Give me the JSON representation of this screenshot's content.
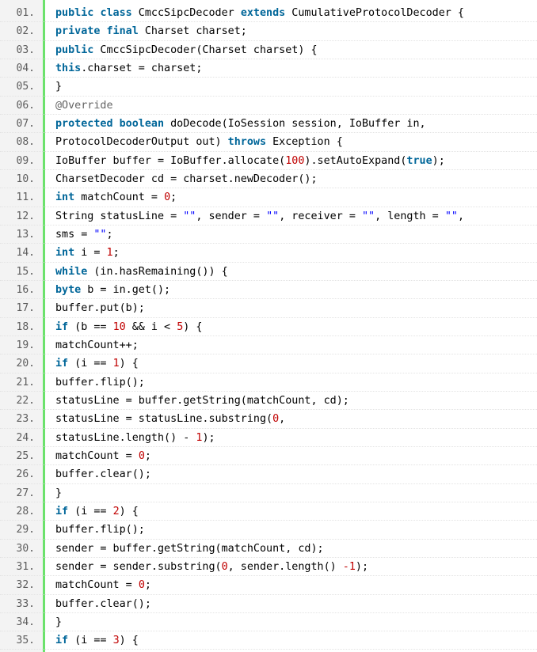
{
  "colors": {
    "keyword": "#006699",
    "number": "#c00000",
    "string": "#0000ff",
    "annotation": "#646464",
    "plain": "#000000",
    "gutter_bg": "#f3f3f3",
    "gutter_border": "#6ce26c",
    "line_number": "#5c5c5c"
  },
  "code": {
    "lines": [
      {
        "num": "01.",
        "tokens": [
          {
            "t": "k",
            "v": "public"
          },
          {
            "t": "p",
            "v": " "
          },
          {
            "t": "k",
            "v": "class"
          },
          {
            "t": "p",
            "v": " CmccSipcDecoder "
          },
          {
            "t": "k",
            "v": "extends"
          },
          {
            "t": "p",
            "v": " CumulativeProtocolDecoder {"
          }
        ]
      },
      {
        "num": "02.",
        "tokens": [
          {
            "t": "k",
            "v": "private"
          },
          {
            "t": "p",
            "v": " "
          },
          {
            "t": "k",
            "v": "final"
          },
          {
            "t": "p",
            "v": " Charset charset;"
          }
        ]
      },
      {
        "num": "03.",
        "tokens": [
          {
            "t": "k",
            "v": "public"
          },
          {
            "t": "p",
            "v": " CmccSipcDecoder(Charset charset) {"
          }
        ]
      },
      {
        "num": "04.",
        "tokens": [
          {
            "t": "k",
            "v": "this"
          },
          {
            "t": "p",
            "v": ".charset = charset;"
          }
        ]
      },
      {
        "num": "05.",
        "tokens": [
          {
            "t": "p",
            "v": "}"
          }
        ]
      },
      {
        "num": "06.",
        "tokens": [
          {
            "t": "a",
            "v": "@Override"
          }
        ]
      },
      {
        "num": "07.",
        "tokens": [
          {
            "t": "k",
            "v": "protected"
          },
          {
            "t": "p",
            "v": " "
          },
          {
            "t": "k",
            "v": "boolean"
          },
          {
            "t": "p",
            "v": " doDecode(IoSession session, IoBuffer in,"
          }
        ]
      },
      {
        "num": "08.",
        "tokens": [
          {
            "t": "p",
            "v": "ProtocolDecoderOutput out) "
          },
          {
            "t": "k",
            "v": "throws"
          },
          {
            "t": "p",
            "v": " Exception {"
          }
        ]
      },
      {
        "num": "09.",
        "tokens": [
          {
            "t": "p",
            "v": "IoBuffer buffer = IoBuffer.allocate("
          },
          {
            "t": "n",
            "v": "100"
          },
          {
            "t": "p",
            "v": ").setAutoExpand("
          },
          {
            "t": "k",
            "v": "true"
          },
          {
            "t": "p",
            "v": ");"
          }
        ]
      },
      {
        "num": "10.",
        "tokens": [
          {
            "t": "p",
            "v": "CharsetDecoder cd = charset.newDecoder();"
          }
        ]
      },
      {
        "num": "11.",
        "tokens": [
          {
            "t": "k",
            "v": "int"
          },
          {
            "t": "p",
            "v": " matchCount = "
          },
          {
            "t": "n",
            "v": "0"
          },
          {
            "t": "p",
            "v": ";"
          }
        ]
      },
      {
        "num": "12.",
        "tokens": [
          {
            "t": "p",
            "v": "String statusLine = "
          },
          {
            "t": "s",
            "v": "\"\""
          },
          {
            "t": "p",
            "v": ", sender = "
          },
          {
            "t": "s",
            "v": "\"\""
          },
          {
            "t": "p",
            "v": ", receiver = "
          },
          {
            "t": "s",
            "v": "\"\""
          },
          {
            "t": "p",
            "v": ", length = "
          },
          {
            "t": "s",
            "v": "\"\""
          },
          {
            "t": "p",
            "v": ","
          }
        ]
      },
      {
        "num": "13.",
        "tokens": [
          {
            "t": "p",
            "v": "sms = "
          },
          {
            "t": "s",
            "v": "\"\""
          },
          {
            "t": "p",
            "v": ";"
          }
        ]
      },
      {
        "num": "14.",
        "tokens": [
          {
            "t": "k",
            "v": "int"
          },
          {
            "t": "p",
            "v": " i = "
          },
          {
            "t": "n",
            "v": "1"
          },
          {
            "t": "p",
            "v": ";"
          }
        ]
      },
      {
        "num": "15.",
        "tokens": [
          {
            "t": "k",
            "v": "while"
          },
          {
            "t": "p",
            "v": " (in.hasRemaining()) {"
          }
        ]
      },
      {
        "num": "16.",
        "tokens": [
          {
            "t": "k",
            "v": "byte"
          },
          {
            "t": "p",
            "v": " b = in.get();"
          }
        ]
      },
      {
        "num": "17.",
        "tokens": [
          {
            "t": "p",
            "v": "buffer.put(b);"
          }
        ]
      },
      {
        "num": "18.",
        "tokens": [
          {
            "t": "k",
            "v": "if"
          },
          {
            "t": "p",
            "v": " (b == "
          },
          {
            "t": "n",
            "v": "10"
          },
          {
            "t": "p",
            "v": " && i < "
          },
          {
            "t": "n",
            "v": "5"
          },
          {
            "t": "p",
            "v": ") {"
          }
        ]
      },
      {
        "num": "19.",
        "tokens": [
          {
            "t": "p",
            "v": "matchCount++;"
          }
        ]
      },
      {
        "num": "20.",
        "tokens": [
          {
            "t": "k",
            "v": "if"
          },
          {
            "t": "p",
            "v": " (i == "
          },
          {
            "t": "n",
            "v": "1"
          },
          {
            "t": "p",
            "v": ") {"
          }
        ]
      },
      {
        "num": "21.",
        "tokens": [
          {
            "t": "p",
            "v": "buffer.flip();"
          }
        ]
      },
      {
        "num": "22.",
        "tokens": [
          {
            "t": "p",
            "v": "statusLine = buffer.getString(matchCount, cd);"
          }
        ]
      },
      {
        "num": "23.",
        "tokens": [
          {
            "t": "p",
            "v": "statusLine = statusLine.substring("
          },
          {
            "t": "n",
            "v": "0"
          },
          {
            "t": "p",
            "v": ","
          }
        ]
      },
      {
        "num": "24.",
        "tokens": [
          {
            "t": "p",
            "v": "statusLine.length() - "
          },
          {
            "t": "n",
            "v": "1"
          },
          {
            "t": "p",
            "v": ");"
          }
        ]
      },
      {
        "num": "25.",
        "tokens": [
          {
            "t": "p",
            "v": "matchCount = "
          },
          {
            "t": "n",
            "v": "0"
          },
          {
            "t": "p",
            "v": ";"
          }
        ]
      },
      {
        "num": "26.",
        "tokens": [
          {
            "t": "p",
            "v": "buffer.clear();"
          }
        ]
      },
      {
        "num": "27.",
        "tokens": [
          {
            "t": "p",
            "v": "}"
          }
        ]
      },
      {
        "num": "28.",
        "tokens": [
          {
            "t": "k",
            "v": "if"
          },
          {
            "t": "p",
            "v": " (i == "
          },
          {
            "t": "n",
            "v": "2"
          },
          {
            "t": "p",
            "v": ") {"
          }
        ]
      },
      {
        "num": "29.",
        "tokens": [
          {
            "t": "p",
            "v": "buffer.flip();"
          }
        ]
      },
      {
        "num": "30.",
        "tokens": [
          {
            "t": "p",
            "v": "sender = buffer.getString(matchCount, cd);"
          }
        ]
      },
      {
        "num": "31.",
        "tokens": [
          {
            "t": "p",
            "v": "sender = sender.substring("
          },
          {
            "t": "n",
            "v": "0"
          },
          {
            "t": "p",
            "v": ", sender.length() "
          },
          {
            "t": "n",
            "v": "-1"
          },
          {
            "t": "p",
            "v": ");"
          }
        ]
      },
      {
        "num": "32.",
        "tokens": [
          {
            "t": "p",
            "v": "matchCount = "
          },
          {
            "t": "n",
            "v": "0"
          },
          {
            "t": "p",
            "v": ";"
          }
        ]
      },
      {
        "num": "33.",
        "tokens": [
          {
            "t": "p",
            "v": "buffer.clear();"
          }
        ]
      },
      {
        "num": "34.",
        "tokens": [
          {
            "t": "p",
            "v": "}"
          }
        ]
      },
      {
        "num": "35.",
        "tokens": [
          {
            "t": "k",
            "v": "if"
          },
          {
            "t": "p",
            "v": " (i == "
          },
          {
            "t": "n",
            "v": "3"
          },
          {
            "t": "p",
            "v": ") {"
          }
        ]
      }
    ]
  }
}
